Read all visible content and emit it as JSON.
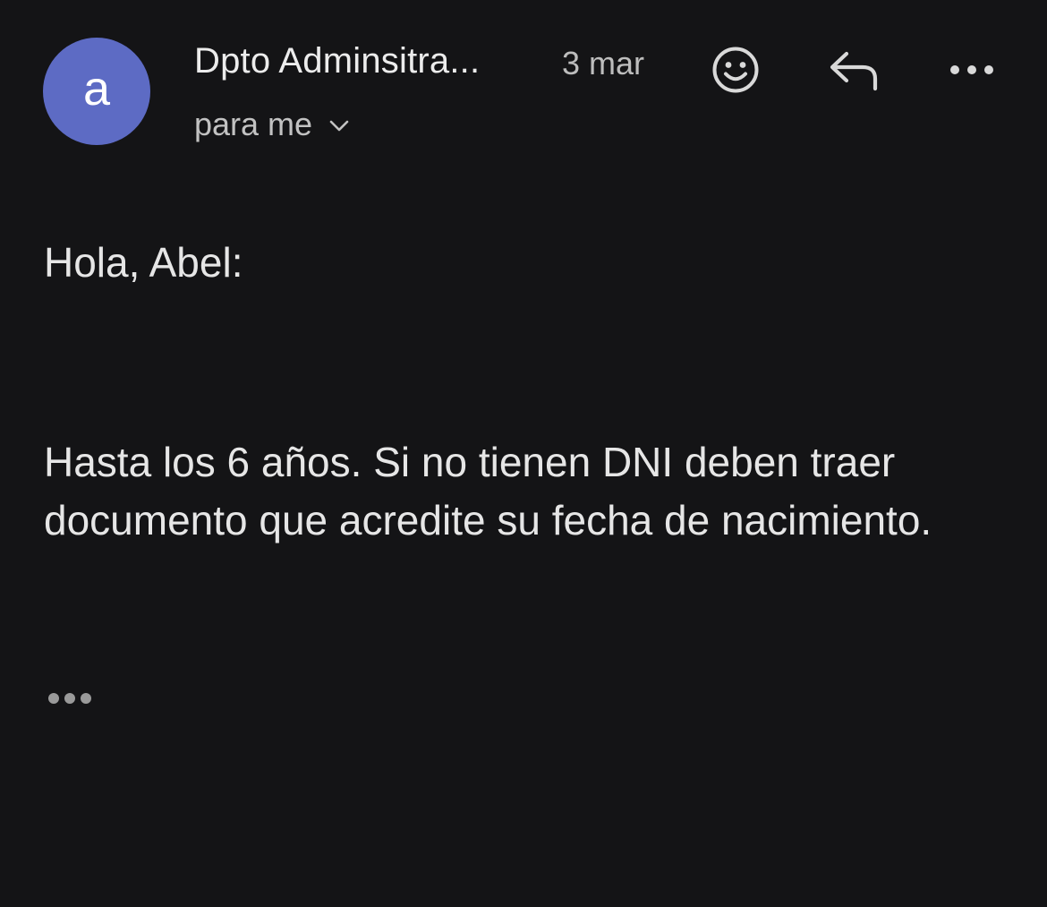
{
  "header": {
    "avatar_letter": "a",
    "avatar_color": "#5d6bc4",
    "sender_name": "Dpto Adminsitra...",
    "date": "3 mar",
    "recipient_label": "para me"
  },
  "icons": {
    "emoji": "smiley-face-icon",
    "reply": "reply-arrow-icon",
    "more": "more-horizontal-icon",
    "recipient_toggle": "chevron-down-icon",
    "expand": "expand-dots-icon"
  },
  "body": {
    "greeting": "Hola, Abel:",
    "message": "Hasta los 6 años. Si no tienen DNI deben traer documento que acredite su fecha de nacimiento."
  },
  "colors": {
    "background": "#141416",
    "text": "#e6e6e6",
    "secondary_text": "#bdbdbd",
    "icon": "#d9d9d9"
  }
}
